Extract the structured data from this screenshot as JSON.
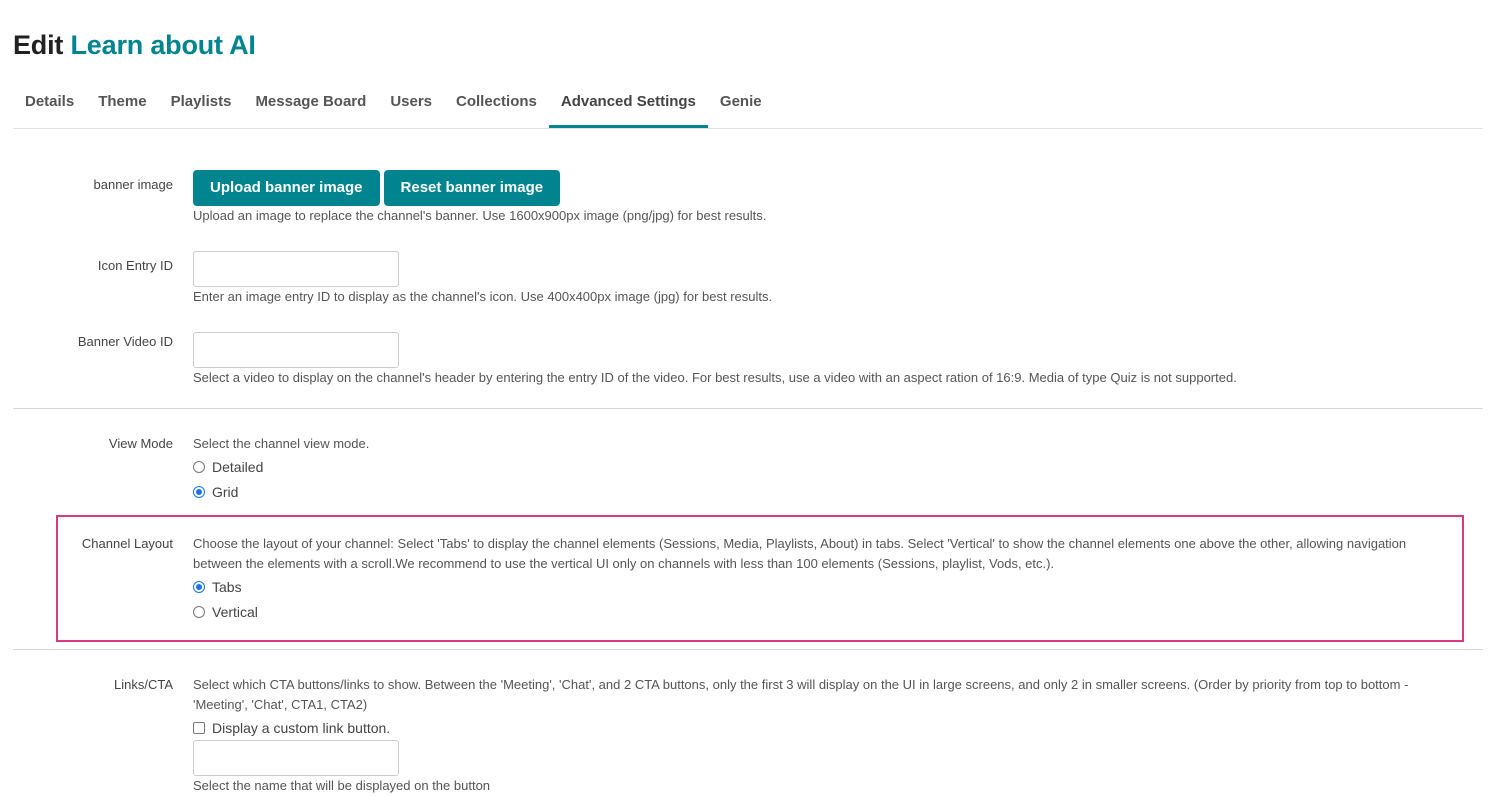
{
  "page": {
    "title_prefix": "Edit",
    "title_name": "Learn about AI"
  },
  "tabs": [
    "Details",
    "Theme",
    "Playlists",
    "Message Board",
    "Users",
    "Collections",
    "Advanced Settings",
    "Genie"
  ],
  "active_tab": "Advanced Settings",
  "banner_image": {
    "label": "banner image",
    "upload_button": "Upload banner image",
    "reset_button": "Reset banner image",
    "help": "Upload an image to replace the channel's banner. Use 1600x900px image (png/jpg) for best results."
  },
  "icon_entry": {
    "label": "Icon Entry ID",
    "value": "",
    "help": "Enter an image entry ID to display as the channel's icon. Use 400x400px image (jpg) for best results."
  },
  "banner_video": {
    "label": "Banner Video ID",
    "value": "",
    "help": "Select a video to display on the channel's header by entering the entry ID of the video. For best results, use a video with an aspect ration of 16:9. Media of type Quiz is not supported."
  },
  "view_mode": {
    "label": "View Mode",
    "description": "Select the channel view mode.",
    "options": [
      "Detailed",
      "Grid"
    ],
    "selected": "Grid"
  },
  "channel_layout": {
    "label": "Channel Layout",
    "description_line1": "Choose the layout of your channel: Select 'Tabs' to display the channel elements (Sessions, Media, Playlists, About) in tabs. Select 'Vertical' to show the channel elements one above the other, allowing navigation",
    "description_line2": "between the elements with a scroll.We recommend to use the vertical UI only on channels with less than 100 elements (Sessions, playlist, Vods, etc.).",
    "options": [
      "Tabs",
      "Vertical"
    ],
    "selected": "Tabs"
  },
  "links_cta": {
    "label": "Links/CTA",
    "description_line1": "Select which CTA buttons/links to show. Between the 'Meeting', 'Chat', and 2 CTA buttons, only the first 3 will display on the UI in large screens, and only 2 in smaller screens. (Order by priority from top to bottom -",
    "description_line2": "'Meeting', 'Chat', CTA1, CTA2)",
    "custom_link_label": "Display a custom link button.",
    "custom_link_checked": false,
    "name_value": "",
    "name_help": "Select the name that will be displayed on the button"
  },
  "colors": {
    "accent": "#00848f",
    "highlight_border": "#d63a80",
    "radio_checked": "#1a73e8"
  }
}
